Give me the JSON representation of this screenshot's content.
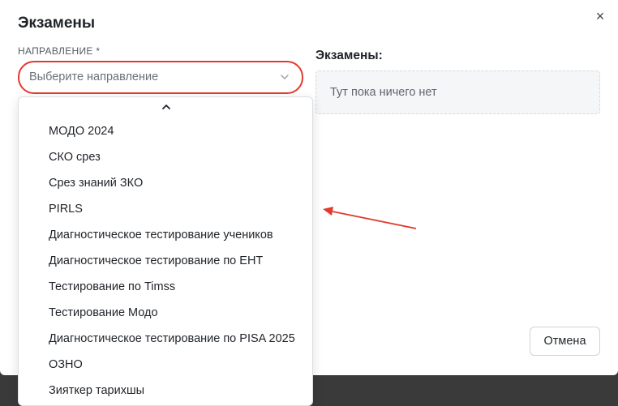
{
  "modal": {
    "title": "Экзамены",
    "close_symbol": "×"
  },
  "direction_field": {
    "label": "НАПРАВЛЕНИЕ *",
    "placeholder": "Выберите направление"
  },
  "dropdown": {
    "options": [
      "МОДО 2024",
      "СКО срез",
      "Срез знаний ЗКО",
      "PIRLS",
      "Диагностическое тестирование учеников",
      "Диагностическое тестирование по ЕНТ",
      "Тестирование по Timss",
      "Тестирование Модо",
      "Диагностическое тестирование по PISA 2025",
      "ОЗНО",
      "Зияткер тарихшы"
    ]
  },
  "exams_panel": {
    "title": "Экзамены:",
    "empty_text": "Тут пока ничего нет"
  },
  "footer": {
    "cancel_label": "Отмена"
  },
  "colors": {
    "highlight": "#e23a2f",
    "backdrop": "#3a3a3a"
  },
  "icons": [
    "close-icon",
    "chevron-down-icon",
    "chevron-up-icon",
    "annotation-arrow"
  ]
}
